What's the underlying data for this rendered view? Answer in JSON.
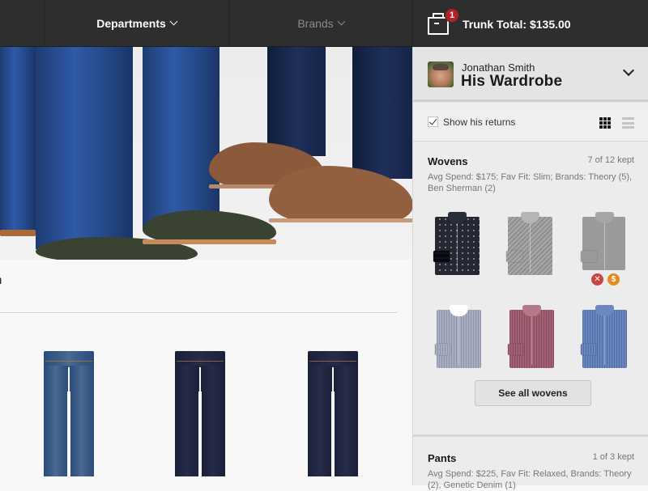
{
  "topnav": {
    "departments_label": "Departments",
    "brands_label": "Brands",
    "trunk_badge_count": "1",
    "trunk_total_label": "Trunk Total: $135.00"
  },
  "main": {
    "section_title": "n",
    "hero_alt": "Jeans and shoes lifestyle photo",
    "products": [
      {
        "name": "Light wash jeans",
        "style": "light"
      },
      {
        "name": "Raw denim jeans",
        "style": "raw"
      },
      {
        "name": "Raw denim jeans",
        "style": "raw"
      }
    ]
  },
  "sidebar": {
    "profile": {
      "name": "Jonathan Smith",
      "title": "His Wardrobe"
    },
    "options": {
      "show_returns_label": "Show his returns",
      "show_returns_checked": true,
      "view_mode": "grid"
    },
    "categories": [
      {
        "title": "Wovens",
        "count": "7 of 12 kept",
        "desc": "Avg Spend: $175; Fav Fit: Slim; Brands: Theory (5), Ben Sherman (2)",
        "items": [
          {
            "name": "Plaid shirt",
            "returned": false
          },
          {
            "name": "Grey pattern shirt",
            "returned": false
          },
          {
            "name": "Grey shirt",
            "returned": true,
            "actions": [
              "return-icon",
              "dollar-icon"
            ]
          },
          {
            "name": "White collar shirt",
            "returned": false
          },
          {
            "name": "Burgundy shirt",
            "returned": false
          },
          {
            "name": "Blue shirt",
            "returned": false
          }
        ],
        "see_all_label": "See all wovens"
      },
      {
        "title": "Pants",
        "count": "1 of 3 kept",
        "desc": "Avg Spend: $225, Fav Fit: Relaxed, Brands: Theory (2), Genetic Denim (1)"
      }
    ],
    "action_icons": {
      "return_glyph": "✕",
      "buy_glyph": "$"
    }
  }
}
